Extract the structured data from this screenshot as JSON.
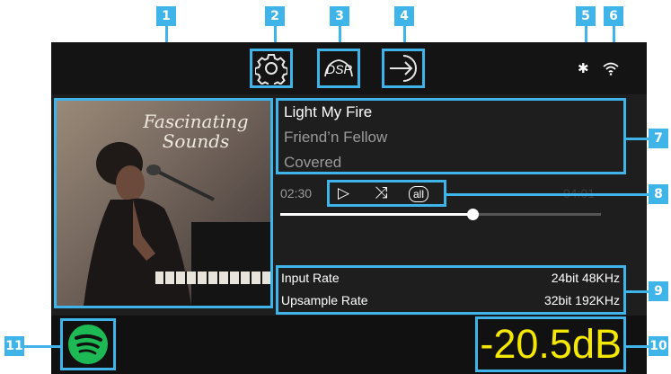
{
  "callouts": [
    "1",
    "2",
    "3",
    "4",
    "5",
    "6",
    "7",
    "8",
    "9",
    "10",
    "11"
  ],
  "album": {
    "title_line1": "Fascinating",
    "title_line2": "Sounds"
  },
  "topbar": {
    "settings_icon": "gear-icon",
    "dsp_label": "DSP",
    "input_icon": "input-arrow-icon",
    "bluetooth_glyph": "✱",
    "wifi_icon": "wifi-icon"
  },
  "track": {
    "title": "Light My Fire",
    "artist": "Friend’n Fellow",
    "album": "Covered"
  },
  "playback": {
    "elapsed": "02:30",
    "total": "04:01",
    "play_glyph": "▷",
    "shuffle_glyph": "⤨",
    "repeat_label": "all",
    "progress_fraction": 0.6
  },
  "rates": {
    "input_label": "Input Rate",
    "input_value": "24bit 48KHz",
    "upsample_label": "Upsample Rate",
    "upsample_value": "32bit 192KHz"
  },
  "volume": "-20.5dB",
  "colors": {
    "accent": "#3fb4e8",
    "volume": "#f5e800",
    "spotify": "#1db954"
  }
}
